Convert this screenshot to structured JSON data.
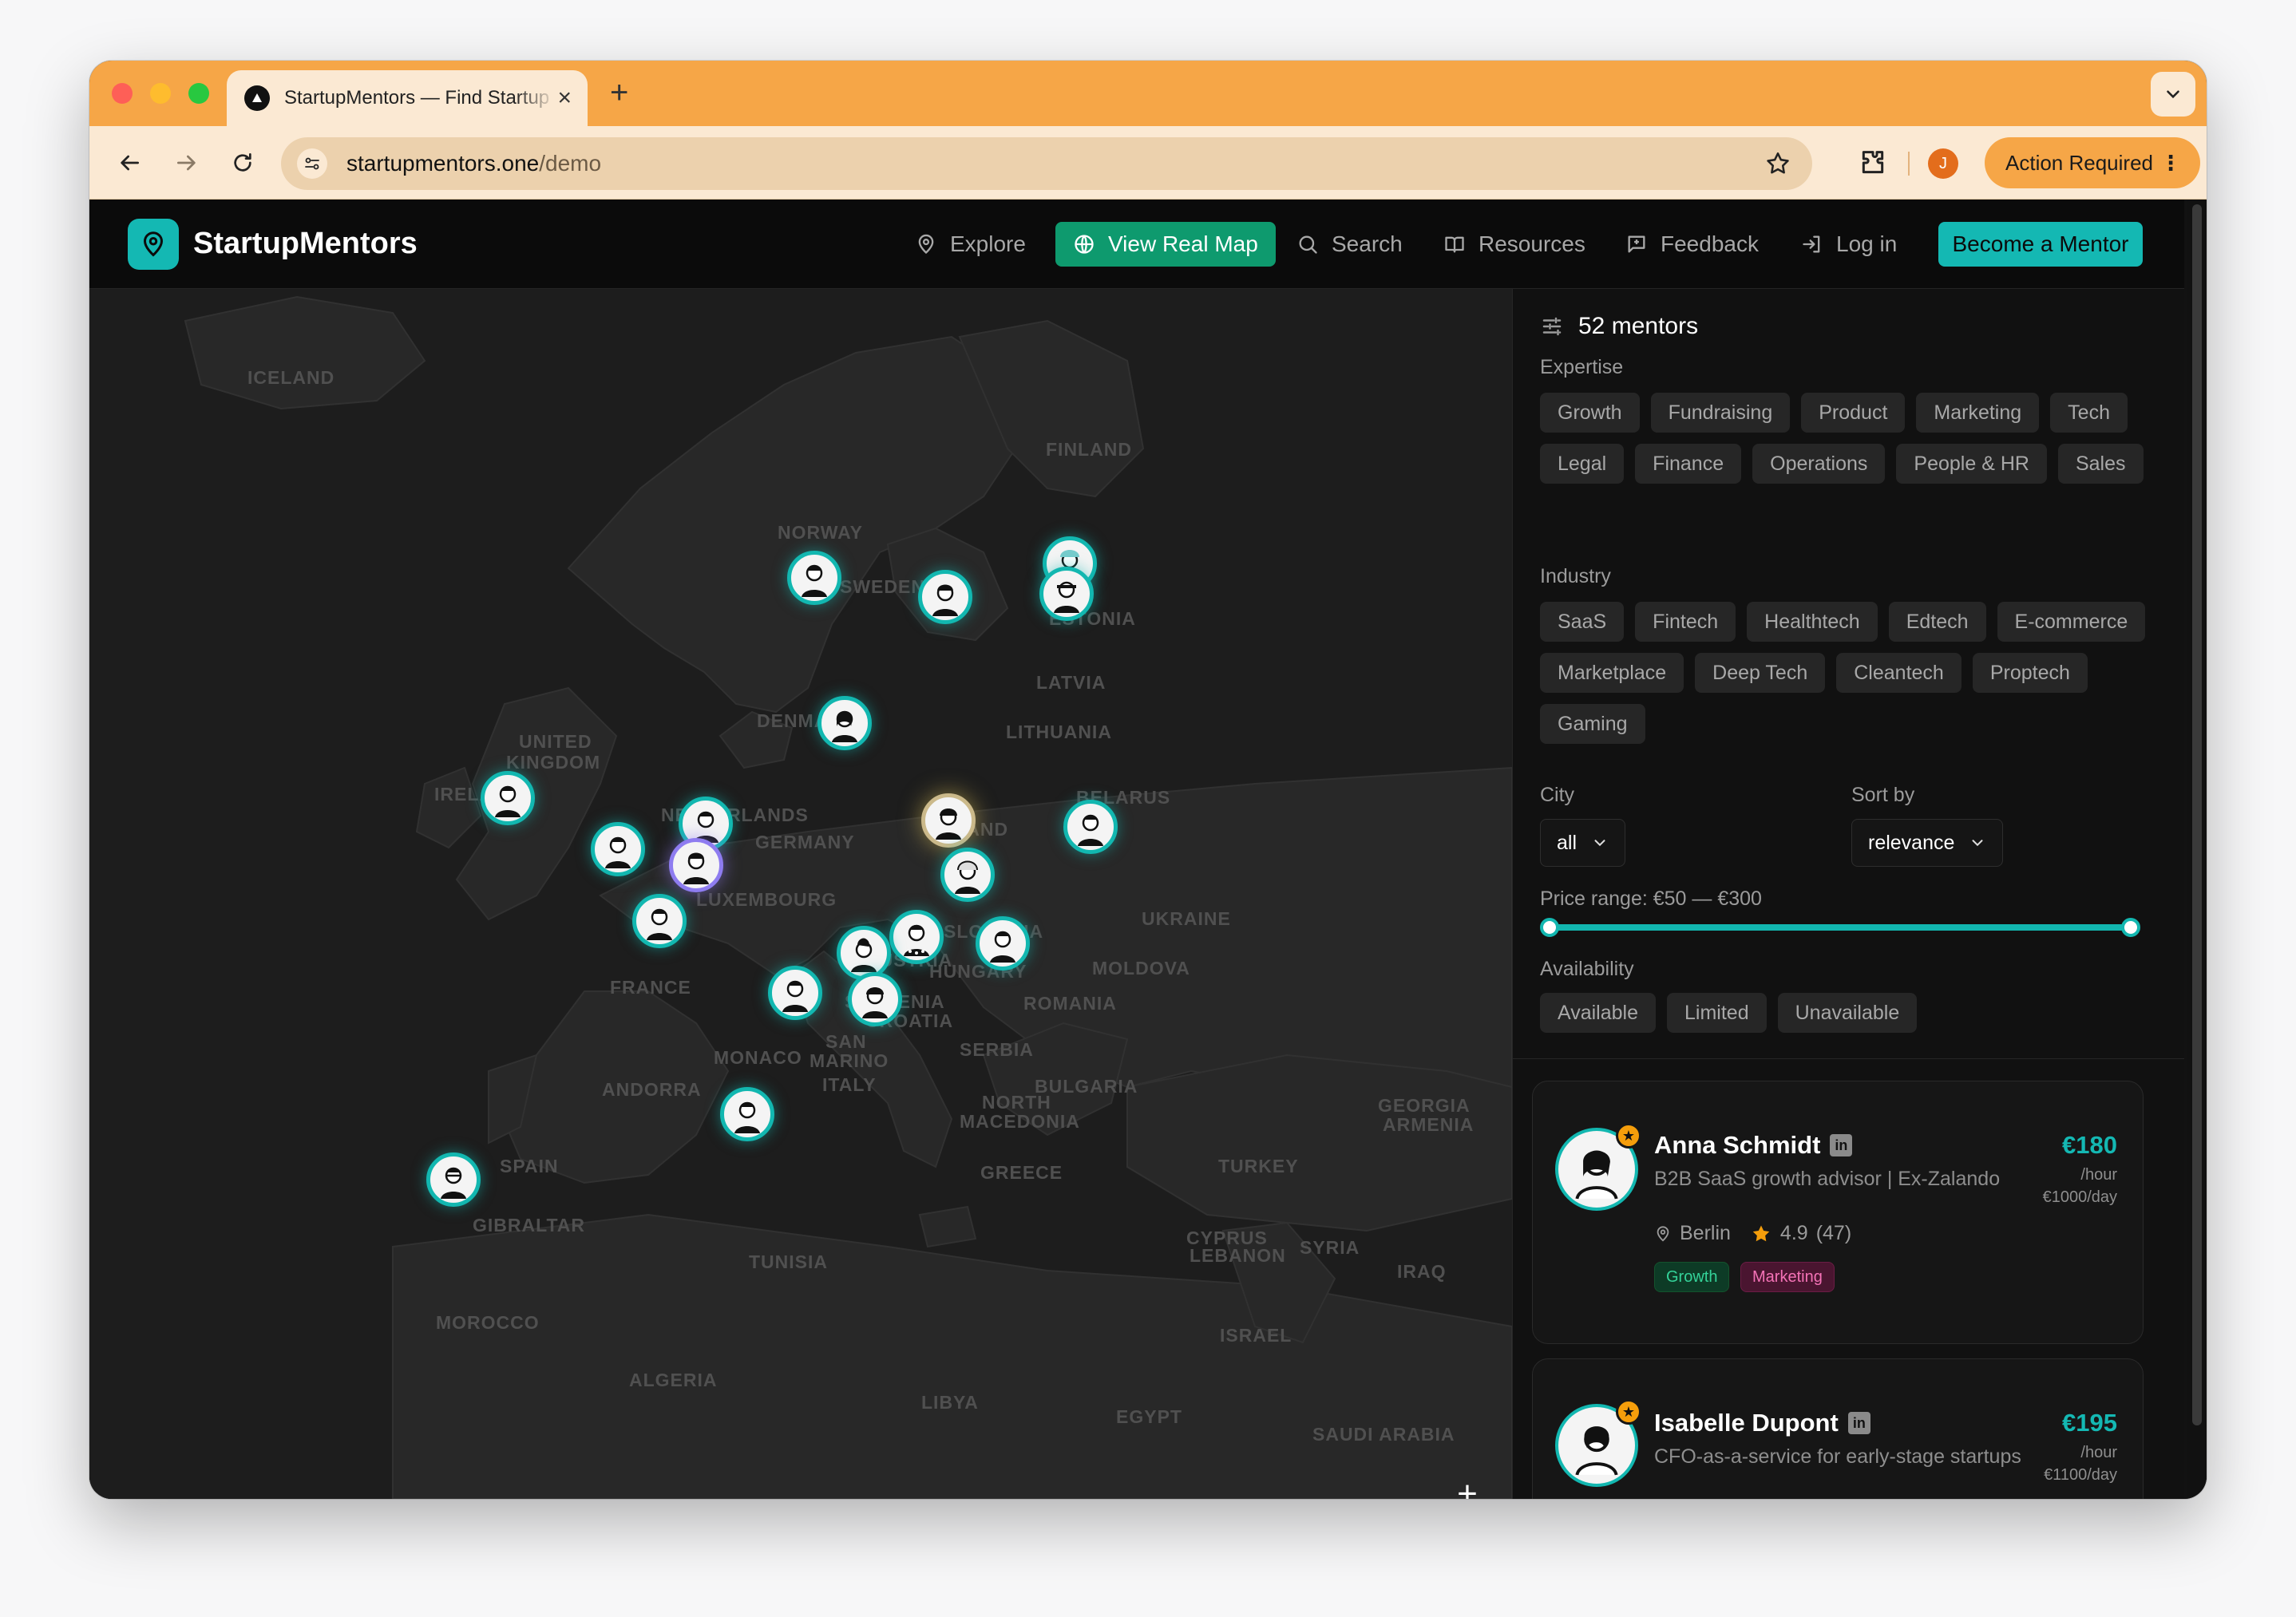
{
  "browser": {
    "tab_title": "StartupMentors — Find Startup Mentors",
    "url_domain": "startupmentors.one",
    "url_path": "/demo",
    "profile_initial": "J",
    "action_label": "Action Required"
  },
  "nav": {
    "brand": "StartupMentors",
    "explore": "Explore",
    "view_map": "View Real Map",
    "search": "Search",
    "resources": "Resources",
    "feedback": "Feedback",
    "login": "Log in",
    "become_mentor": "Become a Mentor"
  },
  "map": {
    "labels": [
      "ICELAND",
      "FINLAND",
      "NORWAY",
      "SWEDEN",
      "ESTONIA",
      "LATVIA",
      "DENMARK",
      "LITHUANIA",
      "UNITED",
      "KINGDOM",
      "IRELAND",
      "BELARUS",
      "NETHERLANDS",
      "GERMANY",
      "POLAND",
      "LUXEMBOURG",
      "UKRAINE",
      "SLOVAKIA",
      "AUSTRIA",
      "HUNGARY",
      "MOLDOVA",
      "FRANCE",
      "SLOVENIA",
      "CROATIA",
      "ROMANIA",
      "SAN",
      "MARINO",
      "MONACO",
      "SERBIA",
      "ITALY",
      "BULGARIA",
      "NORTH",
      "MACEDONIA",
      "GEORGIA",
      "ARMENIA",
      "ANDORRA",
      "SPAIN",
      "GREECE",
      "TURKEY",
      "GIBRALTAR",
      "CYPRUS",
      "SYRIA",
      "LEBANON",
      "IRAQ",
      "TUNISIA",
      "MOROCCO",
      "ISRAEL",
      "ALGERIA",
      "LIBYA",
      "EGYPT",
      "SAUDI ARABIA"
    ],
    "zoom_in": "+",
    "zoom_out": "−"
  },
  "filters": {
    "count_label": "52 mentors",
    "expertise_label": "Expertise",
    "expertise": [
      "Growth",
      "Fundraising",
      "Product",
      "Marketing",
      "Tech",
      "Legal",
      "Finance",
      "Operations",
      "People & HR",
      "Sales"
    ],
    "industry_label": "Industry",
    "industry": [
      "SaaS",
      "Fintech",
      "Healthtech",
      "Edtech",
      "E-commerce",
      "Marketplace",
      "Deep Tech",
      "Cleantech",
      "Proptech",
      "Gaming"
    ],
    "city_label": "City",
    "city_value": "all",
    "sort_label": "Sort by",
    "sort_value": "relevance",
    "price_label": "Price range: €50 — €300",
    "price_min": 50,
    "price_max": 300,
    "availability_label": "Availability",
    "availability": [
      "Available",
      "Limited",
      "Unavailable"
    ]
  },
  "mentors": [
    {
      "name": "Anna Schmidt",
      "subtitle": "B2B SaaS growth advisor | Ex-Zalando",
      "price": "€180",
      "unit": "/hour",
      "day_rate": "€1000/day",
      "city": "Berlin",
      "rating": "4.9",
      "reviews": "(47)",
      "tags": [
        "Growth",
        "Marketing"
      ]
    },
    {
      "name": "Isabelle Dupont",
      "subtitle": "CFO-as-a-service for early-stage startups",
      "price": "€195",
      "unit": "/hour",
      "day_rate": "€1100/day"
    }
  ],
  "colors": {
    "accent": "#14b8b3",
    "nav_active": "#0e9a6e",
    "chrome": "#f6a647",
    "star": "#f59e0b"
  }
}
